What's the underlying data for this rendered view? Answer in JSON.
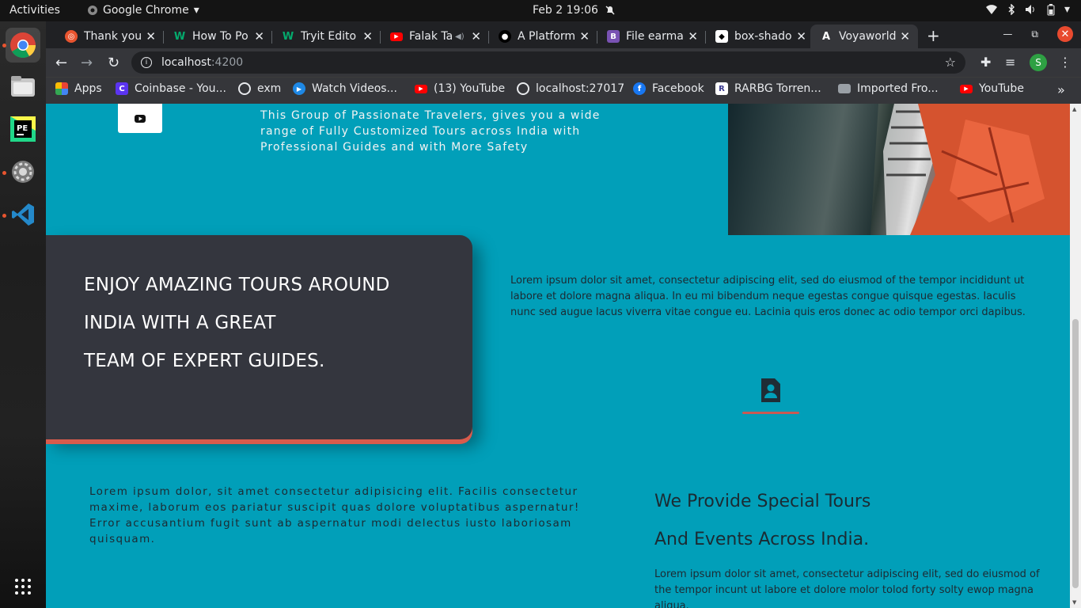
{
  "topbar": {
    "activities": "Activities",
    "app_name": "Google Chrome",
    "clock": "Feb 2  19:06"
  },
  "tabs": [
    {
      "label": "Thank you",
      "color": "#e8542f",
      "icon": "ubuntu-icon"
    },
    {
      "label": "How To Po",
      "color": "#04aa6d",
      "icon": "w3schools-icon"
    },
    {
      "label": "Tryit Edito",
      "color": "#04aa6d",
      "icon": "w3schools-icon"
    },
    {
      "label": "Falak Ta",
      "color": "#ff0000",
      "icon": "youtube-icon"
    },
    {
      "label": "A Platform",
      "color": "#333333",
      "icon": "github-icon"
    },
    {
      "label": "File earma",
      "color": "#7952b3",
      "icon": "bootstrap-icon"
    },
    {
      "label": "box-shado",
      "color": "#000000",
      "icon": "codepen-icon"
    },
    {
      "label": "Voyaworld",
      "color": "#dd0031",
      "icon": "angular-icon"
    }
  ],
  "address": {
    "host": "localhost",
    "port": ":4200"
  },
  "profile_initial": "S",
  "bookmarks": [
    {
      "label": "Apps",
      "icon": "apps-grid-icon"
    },
    {
      "label": "Coinbase - You...",
      "icon": "coinbase-icon"
    },
    {
      "label": "exm",
      "icon": "globe-icon"
    },
    {
      "label": "Watch Videos...",
      "icon": "play-icon"
    },
    {
      "label": "(13) YouTube",
      "icon": "youtube-icon"
    },
    {
      "label": "localhost:27017",
      "icon": "globe-icon"
    },
    {
      "label": "Facebook",
      "icon": "facebook-icon"
    },
    {
      "label": "RARBG Torren...",
      "icon": "rarbg-icon"
    },
    {
      "label": "Imported Fro...",
      "icon": "folder-icon"
    },
    {
      "label": "YouTube",
      "icon": "youtube-icon"
    }
  ],
  "page": {
    "intro": "This Group of Passionate Travelers, gives you a wide range of Fully Customized Tours across India with Professional Guides and with More Safety",
    "hero_lines": [
      "ENJOY AMAZING TOURS AROUND",
      "INDIA WITH A GREAT",
      "TEAM OF EXPERT GUIDES."
    ],
    "para1": "Lorem ipsum dolor sit amet, consectetur adipiscing elit, sed do eiusmod of the tempor incididunt ut labore et dolore magna aliqua. In eu mi bibendum neque egestas congue quisque egestas. Iaculis nunc sed augue lacus viverra vitae congue eu. Lacinia quis eros donec ac odio tempor orci dapibus.",
    "para2": "Lorem ipsum dolor, sit amet consectetur adipisicing elit. Facilis consectetur maxime, laborum eos pariatur suscipit quas dolore voluptatibus aspernatur! Error accusantium fugit sunt ab aspernatur modi delectus iusto laboriosam quisquam.",
    "special_lines": [
      "We Provide Special Tours",
      "And Events Across India."
    ],
    "para3": "Lorem ipsum dolor sit amet, consectetur adipiscing elit, sed do eiusmod of the tempor incunt ut labore et dolore molor tolod forty solty ewop magna aliqua."
  },
  "colors": {
    "page_bg": "#019fb9",
    "card_bg": "#34363e",
    "accent": "#d95b4c"
  }
}
